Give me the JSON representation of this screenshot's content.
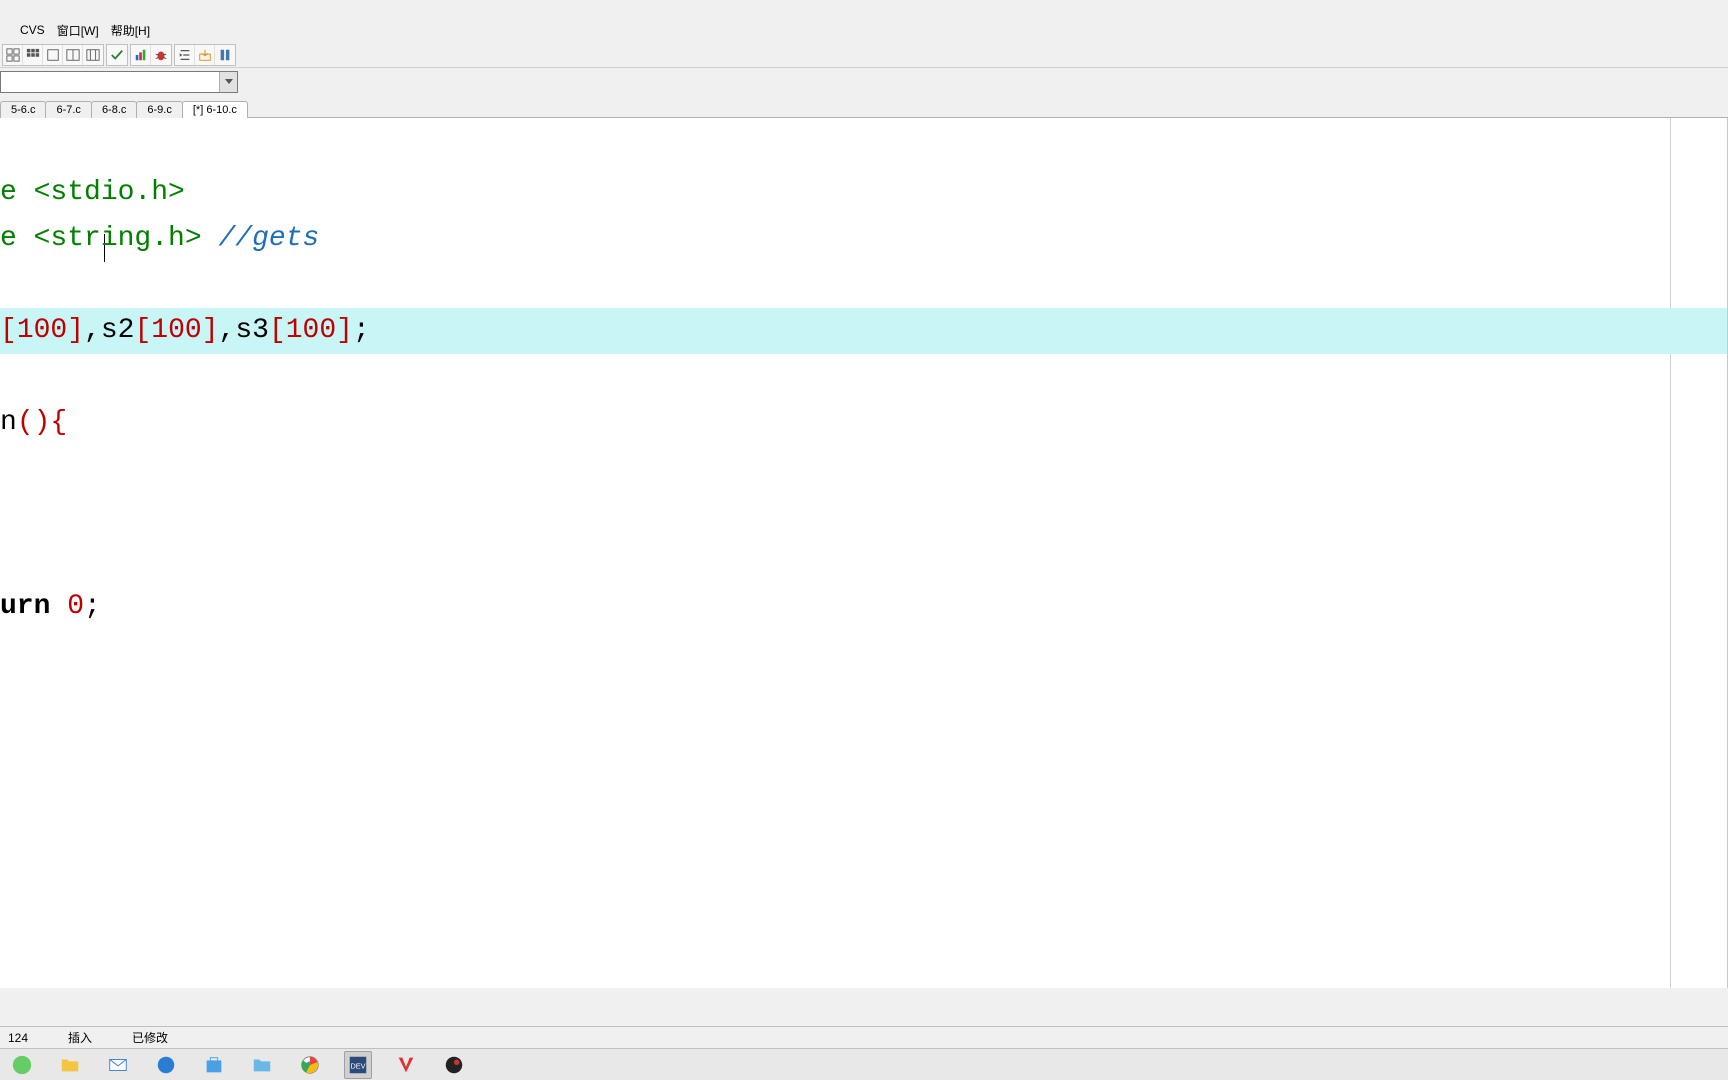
{
  "menu": {
    "items": [
      "",
      "CVS",
      "窗口[W]",
      "帮助[H]"
    ]
  },
  "toolbar": {
    "icons": [
      "grid-icon",
      "grid2-icon",
      "square-icon",
      "panel-icon",
      "panel2-icon",
      "check-icon",
      "chart-icon",
      "bug-icon",
      "indent-icon",
      "inbox-icon",
      "column-icon"
    ]
  },
  "combo": {
    "value": ""
  },
  "tabs": [
    {
      "label": "5-6.c",
      "active": false
    },
    {
      "label": "6-7.c",
      "active": false
    },
    {
      "label": "6-8.c",
      "active": false
    },
    {
      "label": "6-9.c",
      "active": false
    },
    {
      "label": "[*] 6-10.c",
      "active": true
    }
  ],
  "code": {
    "line1_prefix": "e",
    "line1_inc": " <stdio.h>",
    "line2_prefix": "e",
    "line2_inc": " <string.h>",
    "line2_comment": " //gets",
    "line3": "",
    "line4_open": "[",
    "line4_n1": "100",
    "line4_close": "]",
    "line4_s": ",s2",
    "line4_open2": "[",
    "line4_n2": "100",
    "line4_close2": "]",
    "line4_s2": ",s3",
    "line4_open3": "[",
    "line4_n3": "100",
    "line4_close3": "]",
    "line4_end": ";",
    "line5": "",
    "line6_prefix": "n",
    "line6_paren": "(){",
    "line7": "",
    "line8": "",
    "line9": "",
    "line10_kw": "urn",
    "line10_sp": " ",
    "line10_num": "0",
    "line10_end": ";"
  },
  "statusbar": {
    "pos": "124",
    "mode": "插入",
    "state": "已修改"
  },
  "taskbar": {
    "items": [
      "start-icon",
      "files-icon",
      "mail-icon",
      "edge-icon",
      "store-icon",
      "explorer-icon",
      "chrome-icon",
      "devcpp-icon",
      "wps-icon",
      "obs-icon"
    ]
  }
}
